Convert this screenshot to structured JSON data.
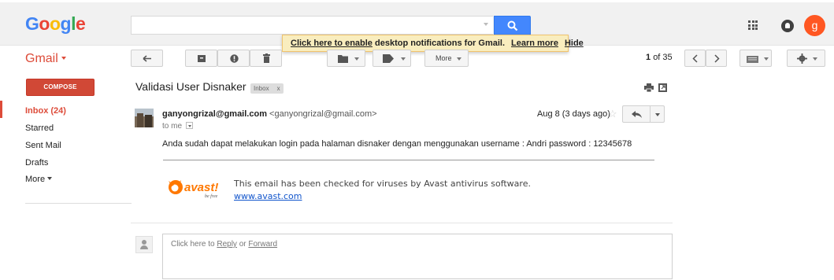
{
  "brand": {
    "logo_text": [
      "G",
      "o",
      "o",
      "g",
      "l",
      "e"
    ],
    "logo_colors": [
      "#4285f4",
      "#ea4335",
      "#fbbc05",
      "#4285f4",
      "#34a853",
      "#ea4335"
    ]
  },
  "header": {
    "search": {
      "value": "",
      "placeholder": ""
    },
    "avatar_letter": "g"
  },
  "notification_banner": {
    "link_text": "Click here to enable",
    "text": "desktop notifications for Gmail.",
    "learn_more": "Learn more",
    "hide": "Hide"
  },
  "app": {
    "label": "Gmail"
  },
  "toolbar": {
    "more_label": "More",
    "page_range": "1",
    "page_total": "of 35"
  },
  "sidebar": {
    "compose_label": "COMPOSE",
    "items": [
      {
        "label": "Inbox (24)",
        "active": true
      },
      {
        "label": "Starred"
      },
      {
        "label": "Sent Mail"
      },
      {
        "label": "Drafts"
      },
      {
        "label": "More"
      }
    ]
  },
  "email": {
    "subject": "Validasi User Disnaker",
    "label": "Inbox",
    "label_close": "x",
    "sender_name": "ganyongrizal@gmail.com",
    "sender_email": "<ganyongrizal@gmail.com>",
    "to": "to me",
    "date": "Aug 8 (3 days ago)",
    "body": "Anda sudah dapat melakukan login pada halaman disnaker dengan menggunakan username : Andri password : 12345678",
    "signature": {
      "logo_text": "avast!",
      "logo_tagline": "be free",
      "text": "This email has been checked for viruses by Avast antivirus software.",
      "link": "www.avast.com"
    }
  },
  "reply": {
    "prefix": "Click here to ",
    "reply_link": "Reply",
    "or": " or ",
    "forward_link": "Forward"
  },
  "colors": {
    "accent_red": "#dd4b39",
    "search_blue": "#4387fd",
    "banner_bg": "#f9edbe"
  }
}
